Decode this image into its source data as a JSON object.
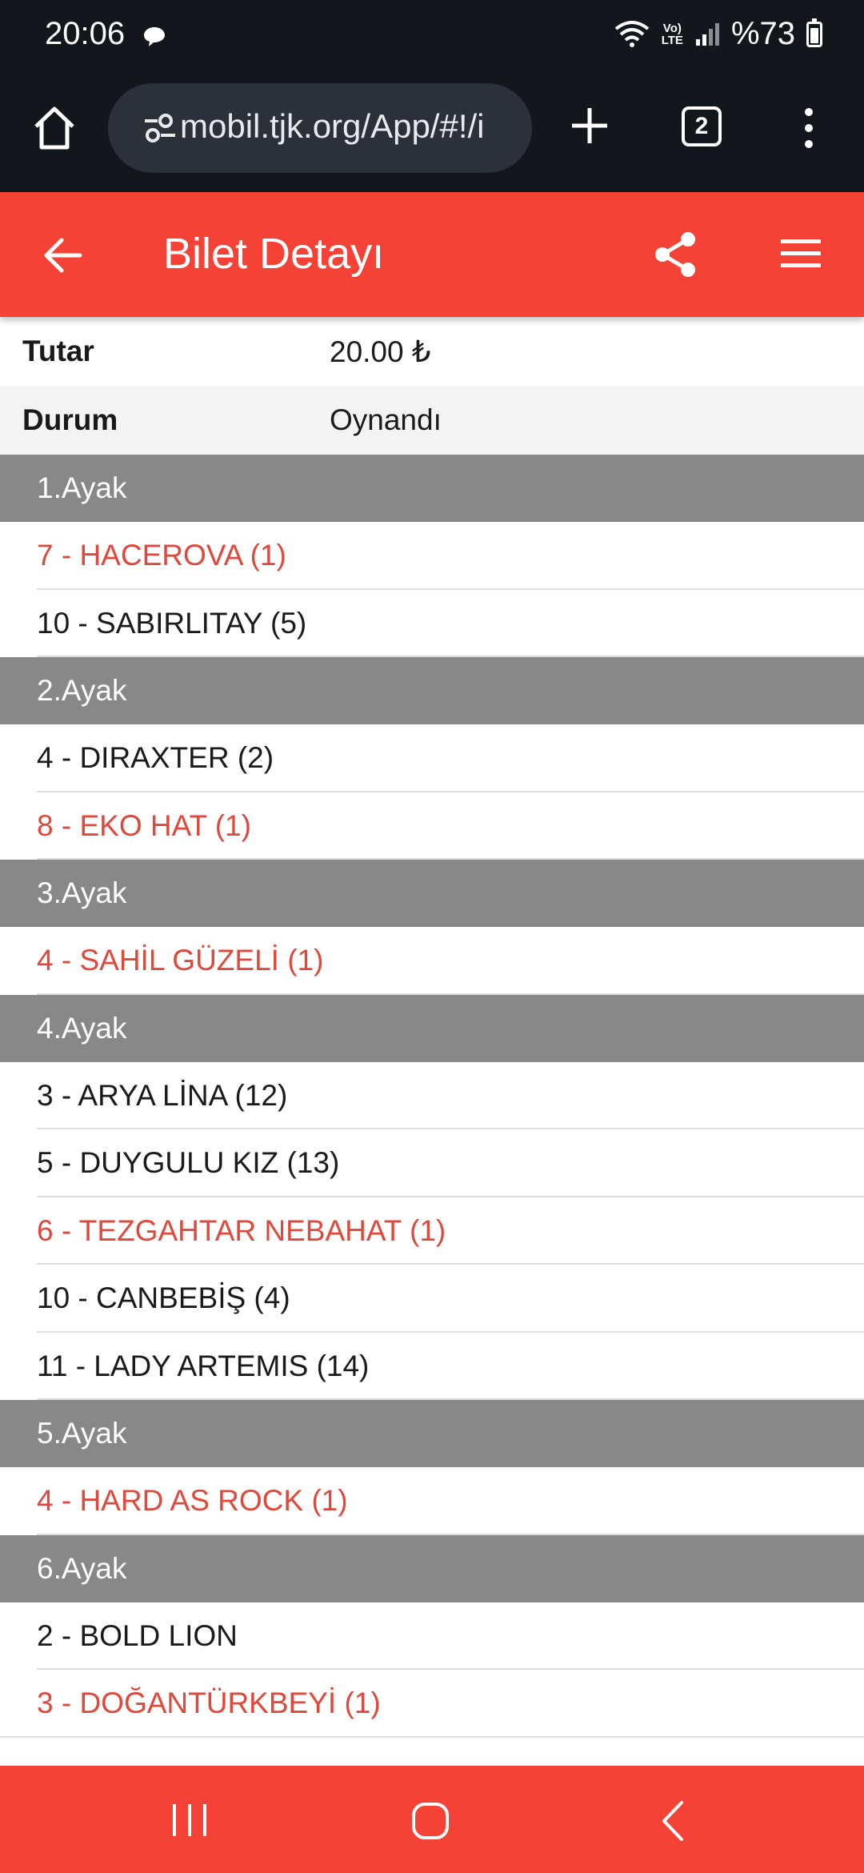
{
  "status_bar": {
    "time": "20:06",
    "network": "Vo)\nLTE",
    "battery": "%73"
  },
  "browser": {
    "url": "mobil.tjk.org/App/#!/i",
    "tab_count": "2"
  },
  "app": {
    "title": "Bilet Detayı",
    "accent_color": "#f44336"
  },
  "info": [
    {
      "label": "Tutar",
      "value": "20.00 ₺"
    },
    {
      "label": "Durum",
      "value": "Oynandı"
    }
  ],
  "legs": [
    {
      "title": "1.Ayak",
      "horses": [
        {
          "text": "7 - HACEROVA (1)",
          "winner": true
        },
        {
          "text": "10 - SABIRLITAY (5)",
          "winner": false
        }
      ]
    },
    {
      "title": "2.Ayak",
      "horses": [
        {
          "text": "4 - DIRAXTER (2)",
          "winner": false
        },
        {
          "text": "8 - EKO HAT (1)",
          "winner": true
        }
      ]
    },
    {
      "title": "3.Ayak",
      "horses": [
        {
          "text": "4 - SAHİL GÜZELİ (1)",
          "winner": true
        }
      ]
    },
    {
      "title": "4.Ayak",
      "horses": [
        {
          "text": "3 - ARYA LİNA (12)",
          "winner": false
        },
        {
          "text": "5 - DUYGULU KIZ (13)",
          "winner": false
        },
        {
          "text": "6 - TEZGAHTAR NEBAHAT (1)",
          "winner": true
        },
        {
          "text": "10 - CANBEBİŞ (4)",
          "winner": false
        },
        {
          "text": "11 - LADY ARTEMIS (14)",
          "winner": false
        }
      ]
    },
    {
      "title": "5.Ayak",
      "horses": [
        {
          "text": "4 - HARD AS ROCK (1)",
          "winner": true
        }
      ]
    },
    {
      "title": "6.Ayak",
      "horses": [
        {
          "text": "2 - BOLD LION",
          "winner": false
        },
        {
          "text": "3 - DOĞANTÜRKBEYİ (1)",
          "winner": true
        }
      ]
    }
  ]
}
